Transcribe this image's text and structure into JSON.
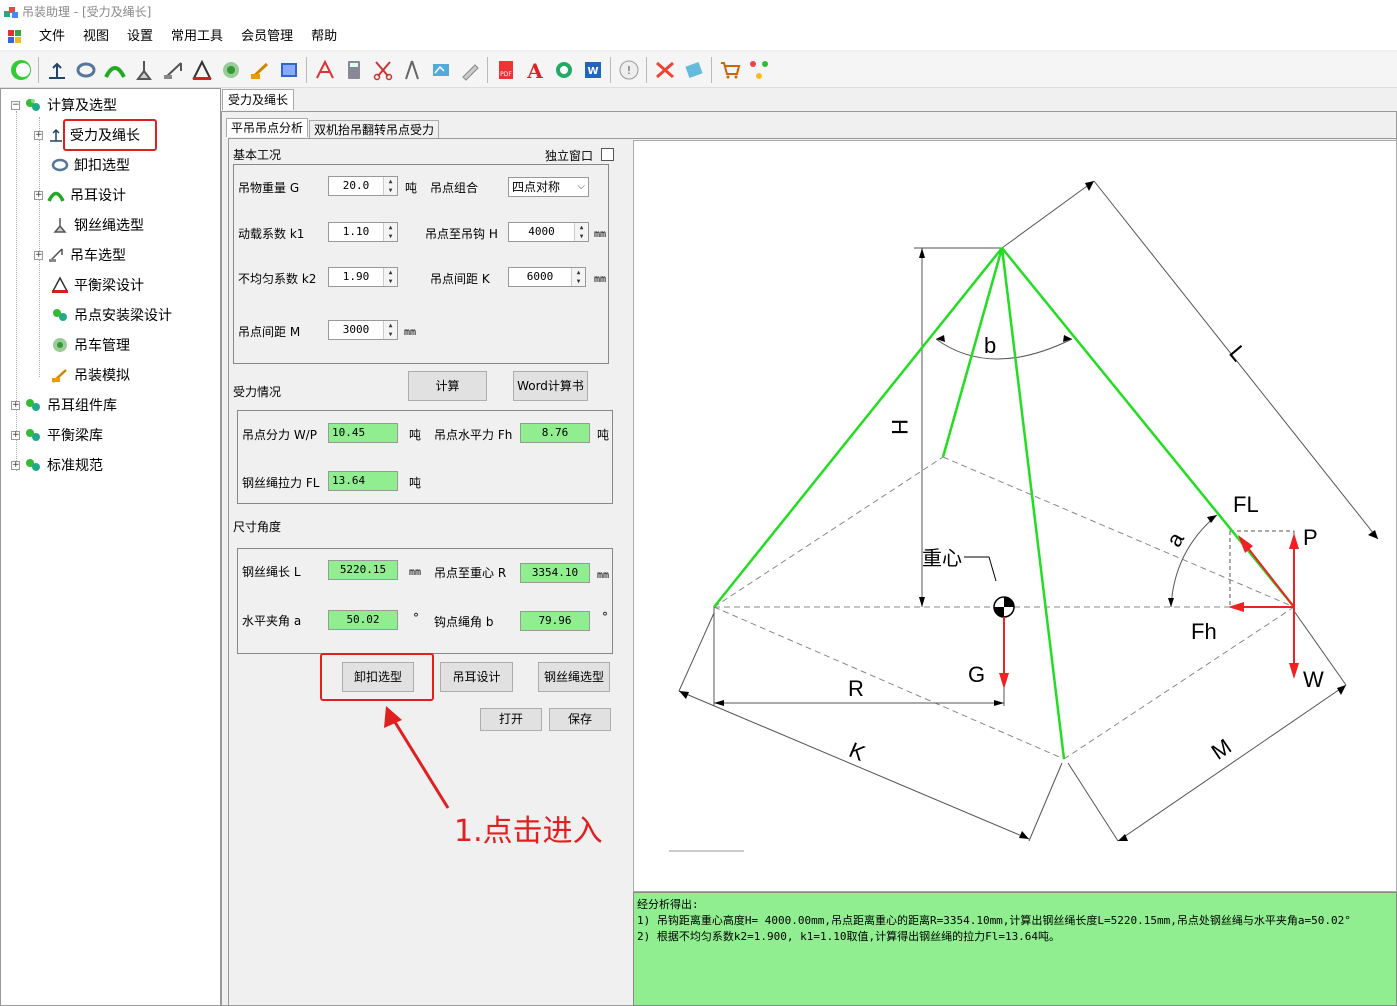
{
  "window": {
    "title": "吊装助理 - [受力及绳长]"
  },
  "menu": {
    "items": [
      "文件",
      "视图",
      "设置",
      "常用工具",
      "会员管理",
      "帮助"
    ]
  },
  "tree": {
    "items": [
      {
        "label": "计算及选型",
        "level": 0
      },
      {
        "label": "受力及绳长",
        "level": 1
      },
      {
        "label": "卸扣选型",
        "level": 1
      },
      {
        "label": "吊耳设计",
        "level": 1
      },
      {
        "label": "钢丝绳选型",
        "level": 1
      },
      {
        "label": "吊车选型",
        "level": 1
      },
      {
        "label": "平衡梁设计",
        "level": 1
      },
      {
        "label": "吊点安装梁设计",
        "level": 1
      },
      {
        "label": "吊车管理",
        "level": 1
      },
      {
        "label": "吊装模拟",
        "level": 1
      },
      {
        "label": "吊耳组件库",
        "level": 0
      },
      {
        "label": "平衡梁库",
        "level": 0
      },
      {
        "label": "标准规范",
        "level": 0
      }
    ]
  },
  "doc_tab": "受力及绳长",
  "sub_tabs": [
    "平吊吊点分析",
    "双机抬吊翻转吊点受力"
  ],
  "basic": {
    "title": "基本工况",
    "standalone_label": "独立窗口",
    "weight_label": "吊物重量 G",
    "weight_value": "20.0",
    "weight_unit": "吨",
    "combo_label": "吊点组合",
    "combo_value": "四点对称",
    "k1_label": "动载系数 k1",
    "k1_value": "1.10",
    "h_label": "吊点至吊钩 H",
    "h_value": "4000",
    "h_unit": "mm",
    "k2_label": "不均匀系数 k2",
    "k2_value": "1.90",
    "k_label": "吊点间距 K",
    "k_value": "6000",
    "k_unit": "mm",
    "m_label": "吊点间距 M",
    "m_value": "3000",
    "m_unit": "mm"
  },
  "buttons": {
    "calc": "计算",
    "word": "Word计算书",
    "shackle": "卸扣选型",
    "lug": "吊耳设计",
    "rope": "钢丝绳选型",
    "open": "打开",
    "save": "保存"
  },
  "force": {
    "title": "受力情况",
    "wp_label": "吊点分力 W/P",
    "wp_value": "10.45",
    "wp_unit": "吨",
    "fh_label": "吊点水平力 Fh",
    "fh_value": "8.76",
    "fh_unit": "吨",
    "fl_label": "钢丝绳拉力 FL",
    "fl_value": "13.64",
    "fl_unit": "吨"
  },
  "dims": {
    "title": "尺寸角度",
    "l_label": "钢丝绳长 L",
    "l_value": "5220.15",
    "l_unit": "mm",
    "r_label": "吊点至重心 R",
    "r_value": "3354.10",
    "r_unit": "mm",
    "a_label": "水平夹角 a",
    "a_value": "50.02",
    "a_unit": "°",
    "b_label": "钩点绳角 b",
    "b_value": "79.96",
    "b_unit": "°"
  },
  "diagram": {
    "labels": {
      "L": "L",
      "H": "H",
      "b": "b",
      "a": "a",
      "FL": "FL",
      "P": "P",
      "Fh": "Fh",
      "W": "W",
      "G": "G",
      "R": "R",
      "K": "K",
      "M": "M",
      "cg": "重心"
    }
  },
  "result": {
    "lines": [
      "经分析得出:",
      "  1) 吊钩距离重心高度H= 4000.00mm,吊点距离重心的距离R=3354.10mm,计算出钢丝绳长度L=5220.15mm,吊点处钢丝绳与水平夹角a=50.02°",
      "  2) 根据不均匀系数k2=1.900, k1=1.10取值,计算得出钢丝绳的拉力Fl=13.64吨。"
    ]
  },
  "annotation": {
    "text": "1.点击进入"
  },
  "colors": {
    "accent_red": "#e02020",
    "green_output": "#90ee90",
    "rope_green": "#22dd22"
  }
}
